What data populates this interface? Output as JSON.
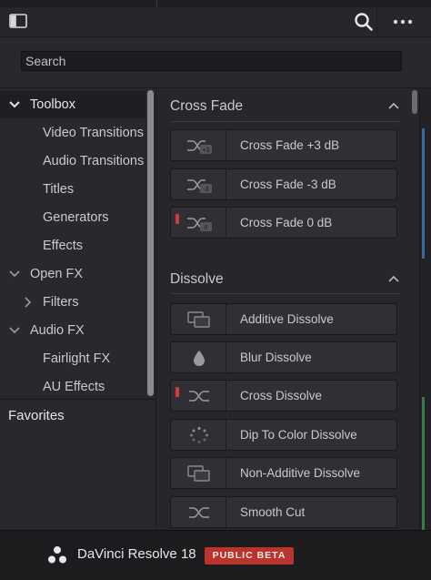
{
  "header": {
    "panel_toggle_icon": "sidebar-toggle-icon",
    "search_icon": "search-icon",
    "more_icon": "more-options-icon"
  },
  "search": {
    "placeholder": "Search",
    "value": ""
  },
  "tree": [
    {
      "label": "Toolbox",
      "expanded": true,
      "selected": true
    },
    {
      "label": "Video Transitions"
    },
    {
      "label": "Audio Transitions"
    },
    {
      "label": "Titles"
    },
    {
      "label": "Generators"
    },
    {
      "label": "Effects"
    },
    {
      "label": "Open FX",
      "expanded": true
    },
    {
      "label": "Filters",
      "expanded": false
    },
    {
      "label": "Audio FX",
      "expanded": true
    },
    {
      "label": "Fairlight FX"
    },
    {
      "label": "AU Effects"
    }
  ],
  "favorites_label": "Favorites",
  "sections": [
    {
      "title": "Cross Fade",
      "items": [
        {
          "label": "Cross Fade +3 dB",
          "icon": "crossfade-plus3-icon",
          "badge": "+3"
        },
        {
          "label": "Cross Fade -3 dB",
          "icon": "crossfade-minus3-icon",
          "badge": "-3"
        },
        {
          "label": "Cross Fade 0 dB",
          "icon": "crossfade-0-icon",
          "badge": "0"
        }
      ]
    },
    {
      "title": "Dissolve",
      "items": [
        {
          "label": "Additive Dissolve",
          "icon": "additive-dissolve-icon"
        },
        {
          "label": "Blur Dissolve",
          "icon": "blur-drop-icon"
        },
        {
          "label": "Cross Dissolve",
          "icon": "cross-dissolve-icon"
        },
        {
          "label": "Dip To Color Dissolve",
          "icon": "dip-to-color-icon"
        },
        {
          "label": "Non-Additive Dissolve",
          "icon": "non-additive-dissolve-icon"
        },
        {
          "label": "Smooth Cut",
          "icon": "smooth-cut-icon"
        }
      ]
    }
  ],
  "footer": {
    "app_name": "DaVinci Resolve 18",
    "badge": "PUBLIC BETA"
  },
  "colors": {
    "accent_red": "#b8342d",
    "marker_red": "#d23c3c"
  }
}
